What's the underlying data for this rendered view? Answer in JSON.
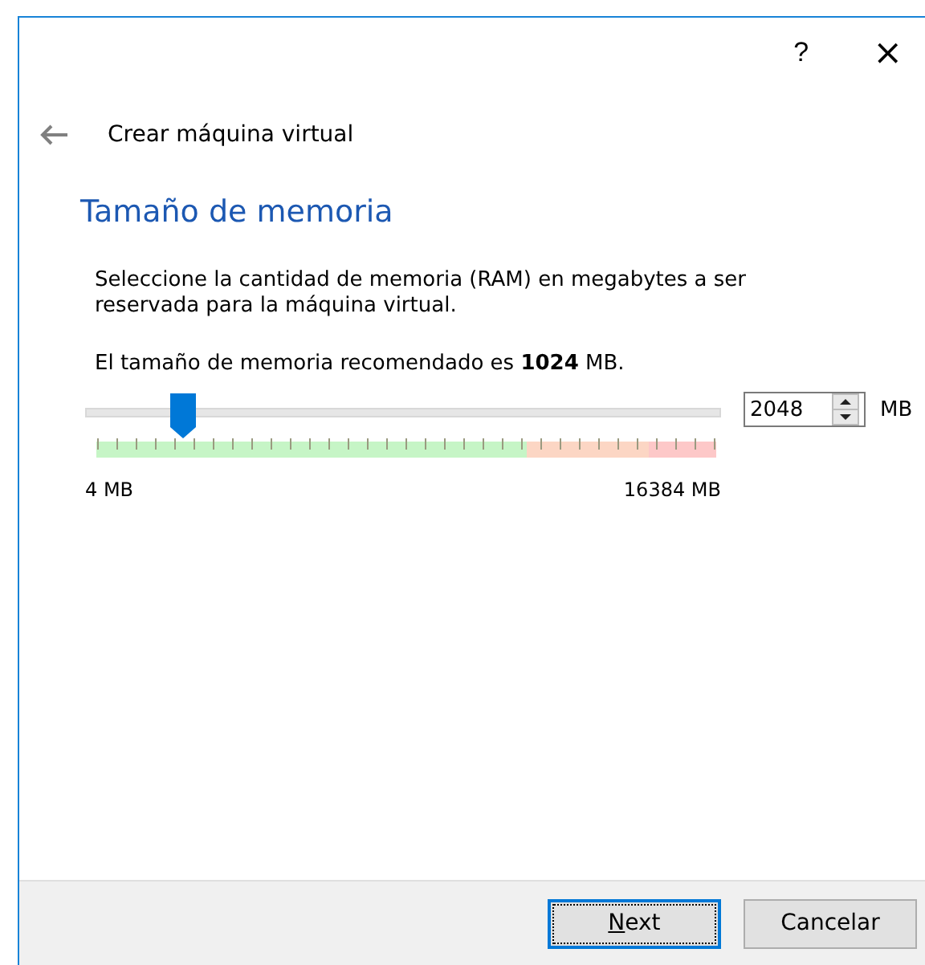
{
  "window": {
    "help": "?",
    "close": "×"
  },
  "header": {
    "title": "Crear máquina virtual"
  },
  "heading": "Tamaño de memoria",
  "description": "Seleccione la cantidad de memoria (RAM) en megabytes a ser reservada para la máquina virtual.",
  "recommendation": "El tamaño de memoria recomendado es **1024** MB.",
  "slider": {
    "level": 0.125,
    "min_label": "4 MB",
    "max_label": "16384 MB"
  },
  "spinbox": {
    "value": "2048",
    "unit": "MB"
  },
  "buttons": [
    {
      "label": "Next",
      "default": true
    },
    {
      "label": "Cancelar",
      "default": false
    }
  ]
}
